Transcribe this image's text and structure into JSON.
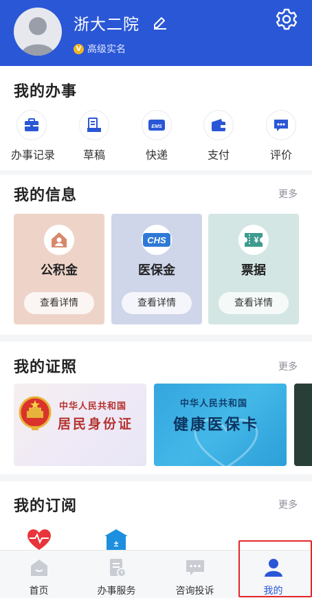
{
  "header": {
    "username": "浙大二院",
    "badge_letter": "V",
    "badge_text": "高级实名"
  },
  "tasks": {
    "title": "我的办事",
    "items": [
      {
        "label": "办事记录",
        "icon": "briefcase-icon"
      },
      {
        "label": "草稿",
        "icon": "draft-icon"
      },
      {
        "label": "快递",
        "icon": "ems-icon"
      },
      {
        "label": "支付",
        "icon": "wallet-icon"
      },
      {
        "label": "评价",
        "icon": "comment-icon"
      }
    ]
  },
  "info": {
    "title": "我的信息",
    "more": "更多",
    "cards": [
      {
        "label": "公积金",
        "button": "查看详情",
        "color": "#eed4c8",
        "icon": "house-icon"
      },
      {
        "label": "医保金",
        "button": "查看详情",
        "color": "#cfd6ea",
        "icon": "chs-icon",
        "icon_text": "CHS"
      },
      {
        "label": "票据",
        "button": "查看详情",
        "color": "#d3e6e3",
        "icon": "ticket-icon",
        "icon_text": "¥"
      }
    ]
  },
  "certs": {
    "title": "我的证照",
    "more": "更多",
    "items": [
      {
        "header": "中华人民共和国",
        "name": "居民身份证"
      },
      {
        "header": "中华人民共和国",
        "name": "健康医保卡"
      }
    ]
  },
  "subscriptions": {
    "title": "我的订阅",
    "more": "更多",
    "icons": [
      "heart-pulse-icon",
      "calculator-icon"
    ]
  },
  "bottom_nav": {
    "items": [
      {
        "label": "首页",
        "icon": "home-icon"
      },
      {
        "label": "办事服务",
        "icon": "service-doc-icon"
      },
      {
        "label": "咨询投诉",
        "icon": "chat-icon"
      },
      {
        "label": "我的",
        "icon": "user-icon",
        "active": true
      }
    ]
  },
  "colors": {
    "brand_blue": "#2a57d6",
    "highlight_red": "#e4252a",
    "badge_gold": "#f0b323"
  }
}
